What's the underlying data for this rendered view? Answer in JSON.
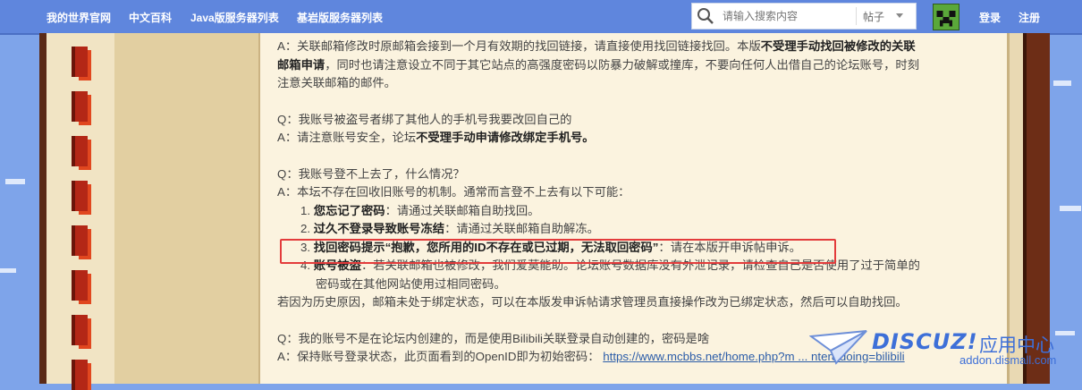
{
  "nav": {
    "links": [
      "我的世界官网",
      "中文百科",
      "Java版服务器列表",
      "基岩版服务器列表"
    ],
    "search_placeholder": "请输入搜索内容",
    "search_type": "帖子",
    "login": "登录",
    "register": "注册"
  },
  "post": {
    "para1_a": "A：关联邮箱修改时原邮箱会接到一个月有效期的找回链接，请直接使用找回链接找回。本版",
    "para1_bold1": "不受理手动找回被修改的关联",
    "para1_line2_bold": "邮箱申请",
    "para1_line2": "，同时也请注意设立不同于其它站点的高强度密码以防暴力破解或撞库，不要向任何人出借自己的论坛账号，时刻",
    "para1_line3": "注意关联邮箱的邮件。",
    "q2": "Q：我账号被盗号者绑了其他人的手机号我要改回自己的",
    "a2_prefix": "A：请注意账号安全，论坛",
    "a2_bold": "不受理手动申请修改绑定手机号。",
    "q3": "Q：我账号登不上去了，什么情况？",
    "a3": "A：本坛不存在回收旧账号的机制。通常而言登不上去有以下可能：",
    "item1_num": "1. ",
    "item1_bold": "您忘记了密码",
    "item1_rest": "：请通过关联邮箱自助找回。",
    "item2_num": "2. ",
    "item2_bold": "过久不登录导致账号冻结",
    "item2_rest": "：请通过关联邮箱自助解冻。",
    "item3_num": "3. ",
    "item3_bold": "找回密码提示“抱歉，您所用的ID不存在或已过期，无法取回密码”",
    "item3_rest": "：请在本版开申诉帖申诉。",
    "item4_num": "4. ",
    "item4_bold": "账号被盗",
    "item4_rest": "：若关联邮箱也被修改，我们爱莫能助。论坛账号数据库没有外泄记录，请检查自己是否使用了过于简单的",
    "item4_line2": "密码或在其他网站使用过相同密码。",
    "history": "若因为历史原因，邮箱未处于绑定状态，可以在本版发申诉帖请求管理员直接操作改为已绑定状态，然后可以自助找回。",
    "q4": "Q：我的账号不是在论坛内创建的，而是使用Bilibili关联登录自动创建的，密码是啥",
    "a4_prefix": "A：保持账号登录状态，此页面看到的OpenID即为初始密码：",
    "a4_link": "https://www.mcbbs.net/home.php?m ... nter&doing=bilibili"
  },
  "watermark": {
    "brand": "DISCUZ!",
    "cn": "应用中心",
    "url": "addon.dismall.com"
  },
  "colors": {
    "sky": "#7ea4ea",
    "nav": "#5f86dd",
    "highlight": "#e33b3b",
    "link": "#2b5ca8"
  }
}
